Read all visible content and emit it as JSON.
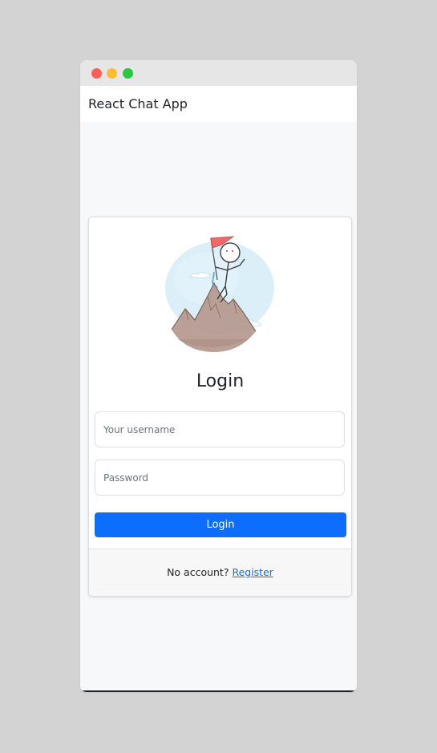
{
  "window": {
    "controls": [
      "close",
      "minimize",
      "maximize"
    ]
  },
  "navbar": {
    "brand": "React Chat App"
  },
  "login_card": {
    "illustration": "mountain-climber-flag-illustration",
    "title": "Login",
    "username_placeholder": "Your username",
    "username_value": "",
    "password_placeholder": "Password",
    "password_value": "",
    "submit_label": "Login",
    "footer_prefix": "No account? ",
    "register_link": "Register"
  },
  "colors": {
    "primary": "#0d6efd",
    "page_bg": "#f7f8fa",
    "outer_bg": "#d3d3d3"
  }
}
